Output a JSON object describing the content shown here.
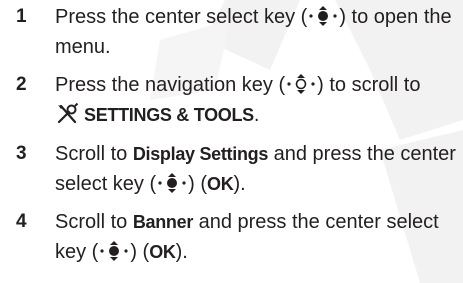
{
  "steps": [
    {
      "number": "1",
      "t1": "Press the center select key (",
      "key": "center-select-key-icon",
      "t2": ") to open the menu."
    },
    {
      "number": "2",
      "t1": "Press the navigation key (",
      "key": "navigation-key-icon",
      "t2": ") to scroll to",
      "menu_icon": "settings-tools-icon",
      "menu_label": "SETTINGS & TOOLS",
      "t3": "."
    },
    {
      "number": "3",
      "t1": "Scroll to ",
      "item": "Display Settings",
      "t2": " and press the center select key (",
      "key": "center-select-key-icon",
      "t3": ") (",
      "softkey": "OK",
      "t4": ")."
    },
    {
      "number": "4",
      "t1": "Scroll to ",
      "item": "Banner",
      "t2": " and press the center select key (",
      "key": "center-select-key-icon",
      "t3": ") (",
      "softkey": "OK",
      "t4": ")."
    }
  ],
  "colors": {
    "text": "#231f20",
    "watermark": "#f2f2f2"
  }
}
